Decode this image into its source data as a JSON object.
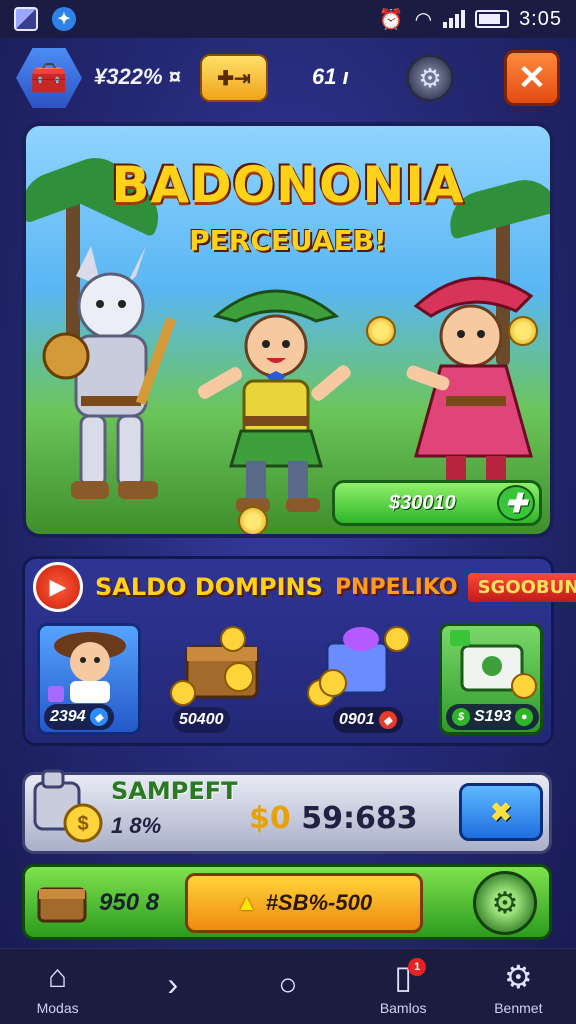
{
  "status_bar": {
    "time": "3:05"
  },
  "top_bar": {
    "currency_amount": "¥322% ¤",
    "ticket_label": "✚⇥",
    "secondary_amount": "61 ı"
  },
  "hero": {
    "title": "BADONONIA",
    "subtitle": "PERCEUAEB!",
    "cta_label": "$30010"
  },
  "shop": {
    "title": "SALDO DOMPINS",
    "tag_1": "PNPELIKO",
    "tag_2": "SGOOBUNG",
    "items": [
      {
        "price": "2394"
      },
      {
        "price": "50400"
      },
      {
        "price": "0901"
      },
      {
        "price": "S193"
      }
    ]
  },
  "timer": {
    "title": "SAMPEFT",
    "percent": "1 8%",
    "currency": "$0",
    "value": "59:683",
    "button_label": "✖"
  },
  "bottom_bar": {
    "count": "950 8",
    "button_label": "#SB%-500"
  },
  "nav": {
    "items": [
      {
        "label": "Modas"
      },
      {
        "label": ""
      },
      {
        "label": ""
      },
      {
        "label": "Bamlos",
        "badge": "1"
      },
      {
        "label": "Benmet"
      }
    ]
  }
}
